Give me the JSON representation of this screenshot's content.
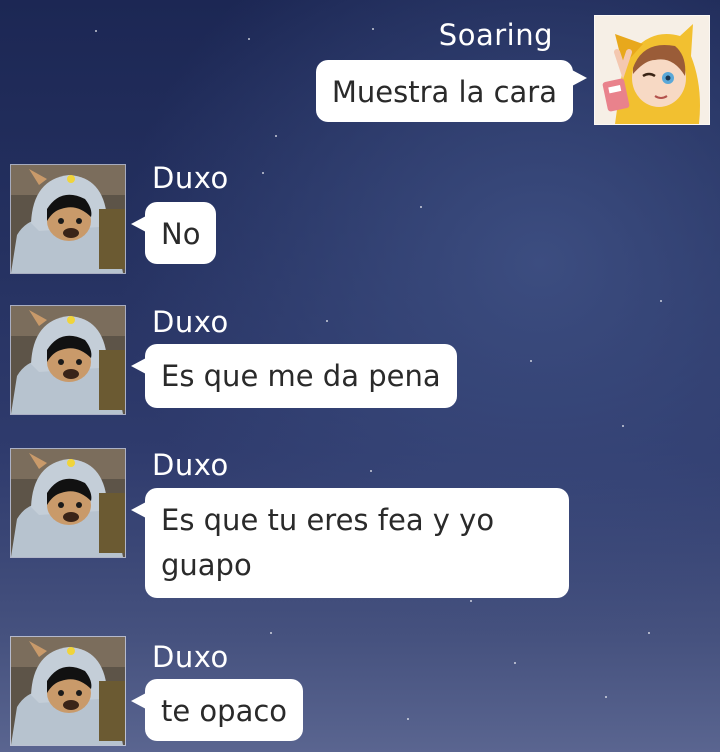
{
  "chat": {
    "messages": [
      {
        "sender": "Soaring",
        "text": "Muestra la cara",
        "side": "right"
      },
      {
        "sender": "Duxo",
        "text": "No",
        "side": "left"
      },
      {
        "sender": "Duxo",
        "text": "Es que me da pena",
        "side": "left"
      },
      {
        "sender": "Duxo",
        "text": "Es que tu eres fea y yo guapo",
        "side": "left"
      },
      {
        "sender": "Duxo",
        "text": "te opaco",
        "side": "left"
      }
    ]
  },
  "colors": {
    "bubble": "#ffffff",
    "name_text": "#ffffff",
    "background_top": "#1c2754",
    "background_bottom": "#5a6590"
  }
}
